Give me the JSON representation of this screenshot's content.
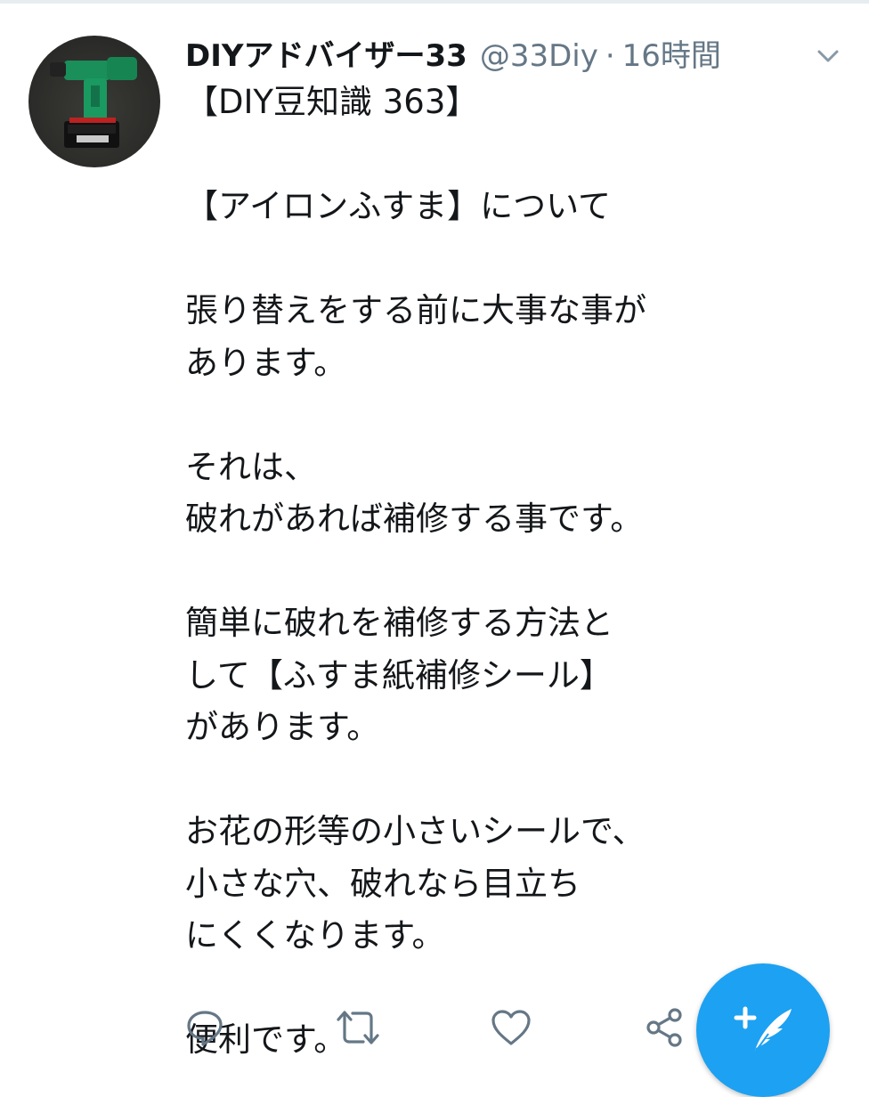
{
  "tweet": {
    "display_name": "DIYアドバイザー33",
    "handle": "@33Diy",
    "separator": "·",
    "time": "16時間",
    "body_lines": [
      "【DIY豆知識 363】",
      "",
      "【アイロンふすま】について",
      "",
      "張り替えをする前に大事な事が",
      "あります。",
      "",
      "それは、",
      "破れがあれば補修する事です。",
      "",
      "簡単に破れを補修する方法と",
      "して【ふすま紙補修シール】",
      "があります。",
      "",
      "お花の形等の小さいシールで、",
      "小さな穴、破れなら目立ち",
      "にくくなります。",
      "",
      "便利です。"
    ]
  },
  "icons": {
    "avatar": "drill-avatar",
    "menu": "chevron-down-icon",
    "reply": "reply-icon",
    "retweet": "retweet-icon",
    "like": "heart-icon",
    "share": "share-icon",
    "compose": "compose-tweet-icon"
  },
  "colors": {
    "accent": "#1da1f2",
    "text": "#14171a",
    "secondary": "#657786",
    "action_icons": "#657786"
  }
}
